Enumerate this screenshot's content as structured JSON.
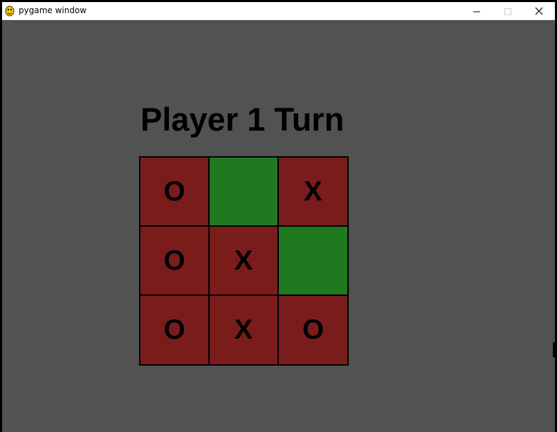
{
  "window": {
    "title": "pygame window",
    "icon": "pygame-snake-icon"
  },
  "game": {
    "status": "Player 1 Turn",
    "colors": {
      "background": "#525252",
      "occupied": "#7a1c1c",
      "empty": "#1f7a1f"
    },
    "board": [
      [
        "O",
        "",
        "X"
      ],
      [
        "O",
        "X",
        ""
      ],
      [
        "O",
        "X",
        "O"
      ]
    ]
  }
}
